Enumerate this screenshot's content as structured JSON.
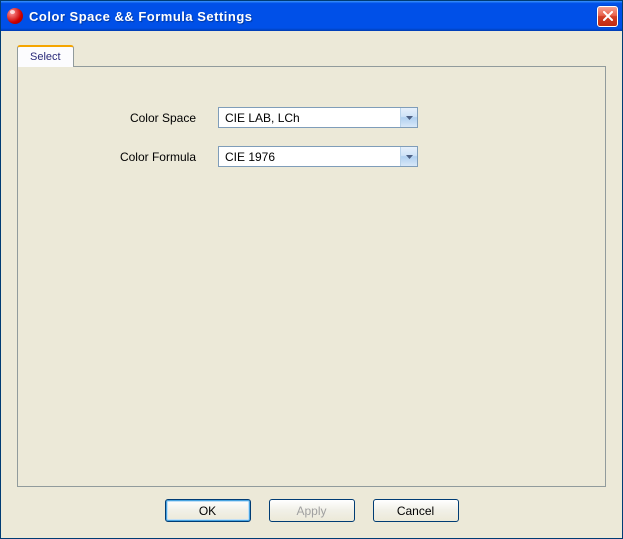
{
  "window": {
    "title": "Color Space && Formula Settings"
  },
  "tabs": {
    "select_label": "Select"
  },
  "form": {
    "color_space_label": "Color Space",
    "color_space_value": "CIE LAB, LCh",
    "color_formula_label": "Color Formula",
    "color_formula_value": "CIE 1976"
  },
  "buttons": {
    "ok": "OK",
    "apply": "Apply",
    "cancel": "Cancel"
  }
}
